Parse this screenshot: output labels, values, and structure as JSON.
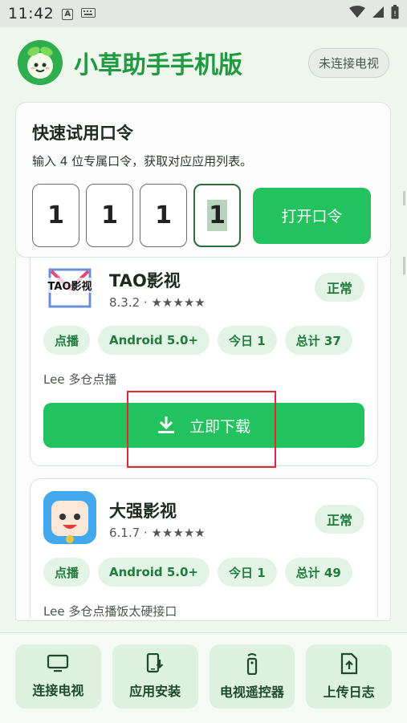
{
  "status_bar": {
    "time": "11:42",
    "icon_a": "A"
  },
  "header": {
    "title": "小草助手手机版",
    "tv_status": "未连接电视"
  },
  "code_card": {
    "title": "快速试用口令",
    "description": "输入 4 位专属口令，获取对应应用列表。",
    "digits": [
      "1",
      "1",
      "1",
      "1"
    ],
    "open_button": "打开口令"
  },
  "apps": [
    {
      "name": "TAO影视",
      "icon_text": "TAO影视",
      "meta": "8.3.2 · ★★★★★",
      "status": "正常",
      "tags": [
        "点播",
        "Android 5.0+",
        "今日 1",
        "总计 37"
      ],
      "description": "Lee 多仓点播",
      "download_label": "立即下载"
    },
    {
      "name": "大强影视",
      "meta": "6.1.7 · ★★★★★",
      "status": "正常",
      "tags": [
        "点播",
        "Android 5.0+",
        "今日 1",
        "总计 49"
      ],
      "description": "Lee 多仓点播饭太硬接口"
    }
  ],
  "bottom_nav": [
    {
      "label": "连接电视",
      "icon": "tv-icon"
    },
    {
      "label": "应用安装",
      "icon": "phone-download-icon"
    },
    {
      "label": "电视遥控器",
      "icon": "remote-icon"
    },
    {
      "label": "上传日志",
      "icon": "upload-file-icon"
    }
  ],
  "colors": {
    "accent": "#22c35f",
    "brand_text": "#1f9a3f",
    "tag_bg": "#e3f4e6",
    "highlight": "#e02b2b"
  }
}
